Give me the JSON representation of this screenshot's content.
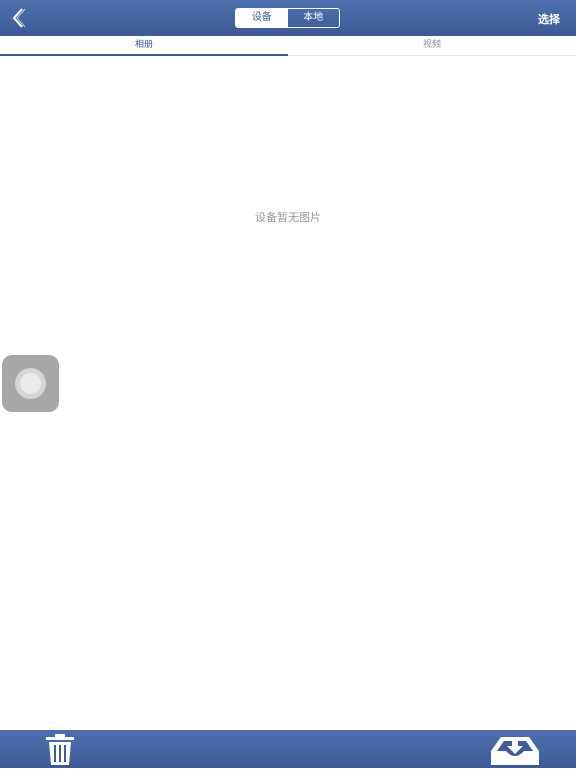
{
  "header": {
    "back_icon": "chevron-left-icon",
    "segments": [
      "设备",
      "本地"
    ],
    "active_segment": "设备",
    "select_label": "选择"
  },
  "tabs": [
    {
      "label": "相册",
      "active": true
    },
    {
      "label": "视频",
      "active": false
    }
  ],
  "main": {
    "empty_message": "设备暂无图片"
  },
  "overlay": {
    "assistive_touch_icon": "assistive-touch-icon"
  },
  "toolbar": {
    "delete_icon": "trash-icon",
    "download_icon": "download-tray-icon"
  },
  "colors": {
    "bar_top": "#4e6fae",
    "bar_bottom": "#3c5a97",
    "accent": "#3d5b98",
    "muted_text": "#9a9a9a"
  }
}
